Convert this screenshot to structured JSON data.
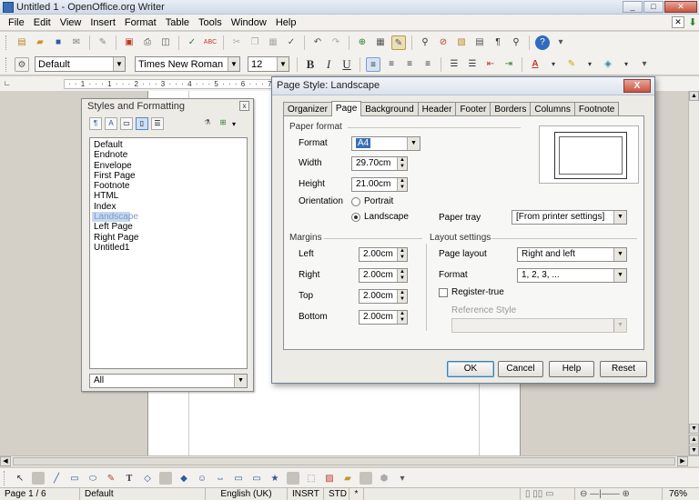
{
  "window": {
    "title": "Untitled 1 - OpenOffice.org Writer",
    "minimize": "_",
    "maximize": "□",
    "close": "✕"
  },
  "menubar": {
    "items": [
      "File",
      "Edit",
      "View",
      "Insert",
      "Format",
      "Table",
      "Tools",
      "Window",
      "Help"
    ],
    "close_doc": "✕"
  },
  "formatting": {
    "paragraph_style": "Default",
    "font_name": "Times New Roman",
    "font_size": "12"
  },
  "ruler_text": "· · 1 · · · 1 · · · 2 · · · 3 · · · 4 · · · 5 · · · 6 · · · 7 · · · 8 · · · 9 · · · 10",
  "stylist": {
    "title": "Styles and Formatting",
    "close": "x",
    "styles": [
      "Default",
      "Endnote",
      "Envelope",
      "First Page",
      "Footnote",
      "HTML",
      "Index",
      "Landscape",
      "Left Page",
      "Right Page",
      "Untitled1"
    ],
    "selected": "Landscape",
    "filter": "All"
  },
  "dialog": {
    "title": "Page Style: Landscape",
    "close": "X",
    "tabs": [
      "Organizer",
      "Page",
      "Background",
      "Header",
      "Footer",
      "Borders",
      "Columns",
      "Footnote"
    ],
    "active_tab": "Page",
    "paper_format": {
      "section": "Paper format",
      "format_label": "Format",
      "format_value": "A4",
      "width_label": "Width",
      "width_value": "29.70cm",
      "height_label": "Height",
      "height_value": "21.00cm",
      "orientation_label": "Orientation",
      "portrait_label": "Portrait",
      "landscape_label": "Landscape",
      "orientation_value": "Landscape",
      "paper_tray_label": "Paper tray",
      "paper_tray_value": "[From printer settings]"
    },
    "margins": {
      "section": "Margins",
      "left_label": "Left",
      "left_value": "2.00cm",
      "right_label": "Right",
      "right_value": "2.00cm",
      "top_label": "Top",
      "top_value": "2.00cm",
      "bottom_label": "Bottom",
      "bottom_value": "2.00cm"
    },
    "layout": {
      "section": "Layout settings",
      "page_layout_label": "Page layout",
      "page_layout_value": "Right and left",
      "format_label": "Format",
      "format_value": "1, 2, 3, ...",
      "register_true_label": "Register-true",
      "register_true_checked": false,
      "reference_style_label": "Reference Style",
      "reference_style_value": ""
    },
    "buttons": {
      "ok": "OK",
      "cancel": "Cancel",
      "help": "Help",
      "reset": "Reset"
    }
  },
  "statusbar": {
    "page": "Page 1 / 6",
    "style": "Default",
    "language": "English (UK)",
    "insert_mode": "INSRT",
    "selection_mode": "STD",
    "modified": "*",
    "zoom": "76%"
  },
  "colors": {
    "selection": "#3b6fb6",
    "dialog_close": "#c9553f",
    "title_bar": "#cfd9e8"
  }
}
